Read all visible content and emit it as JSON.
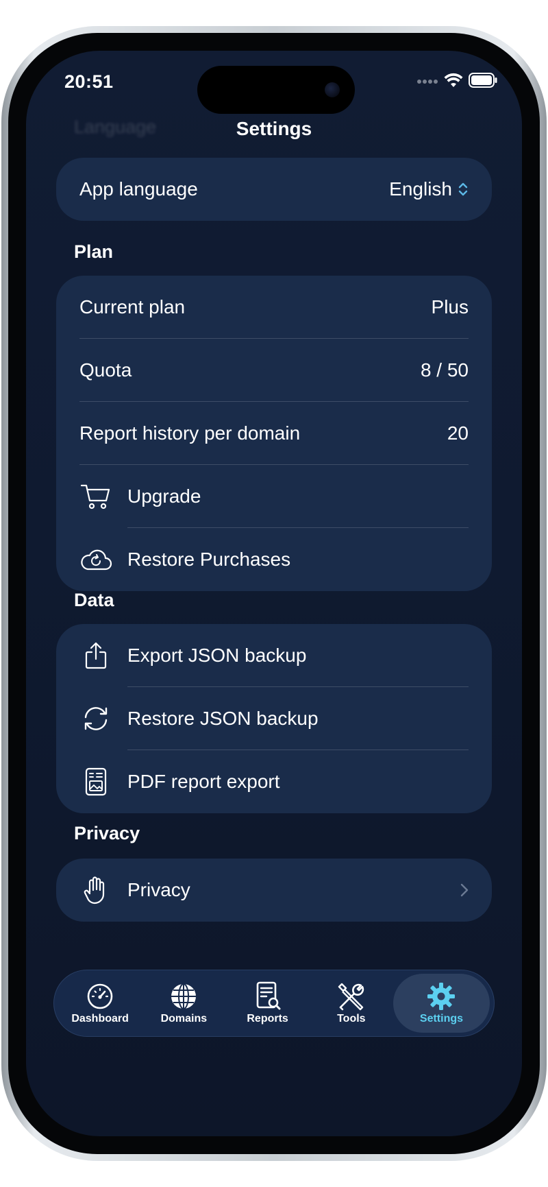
{
  "status_bar": {
    "time": "20:51"
  },
  "nav": {
    "ghost_title": "Language",
    "title": "Settings"
  },
  "language": {
    "label": "App language",
    "value": "English"
  },
  "plan": {
    "header": "Plan",
    "current_plan": {
      "label": "Current plan",
      "value": "Plus"
    },
    "quota": {
      "label": "Quota",
      "value": "8 / 50"
    },
    "history": {
      "label": "Report history per domain",
      "value": "20"
    },
    "upgrade": {
      "label": "Upgrade",
      "icon": "cart-icon"
    },
    "restore": {
      "label": "Restore Purchases",
      "icon": "cloud-refresh-icon"
    }
  },
  "data": {
    "header": "Data",
    "export": {
      "label": "Export JSON backup",
      "icon": "share-icon"
    },
    "restore": {
      "label": "Restore JSON backup",
      "icon": "sync-icon"
    },
    "pdf": {
      "label": "PDF report export",
      "icon": "document-image-icon"
    }
  },
  "privacy": {
    "header": "Privacy",
    "item": {
      "label": "Privacy",
      "icon": "hand-icon"
    }
  },
  "tabs": [
    {
      "label": "Dashboard",
      "icon": "gauge-icon"
    },
    {
      "label": "Domains",
      "icon": "globe-icon"
    },
    {
      "label": "Reports",
      "icon": "report-search-icon"
    },
    {
      "label": "Tools",
      "icon": "tools-icon"
    },
    {
      "label": "Settings",
      "icon": "gear-icon",
      "active": true
    }
  ],
  "colors": {
    "accent": "#5cb8e6",
    "card": "#1a2c4a",
    "background": "#111c33",
    "active_tab": "#5cd0f0"
  }
}
